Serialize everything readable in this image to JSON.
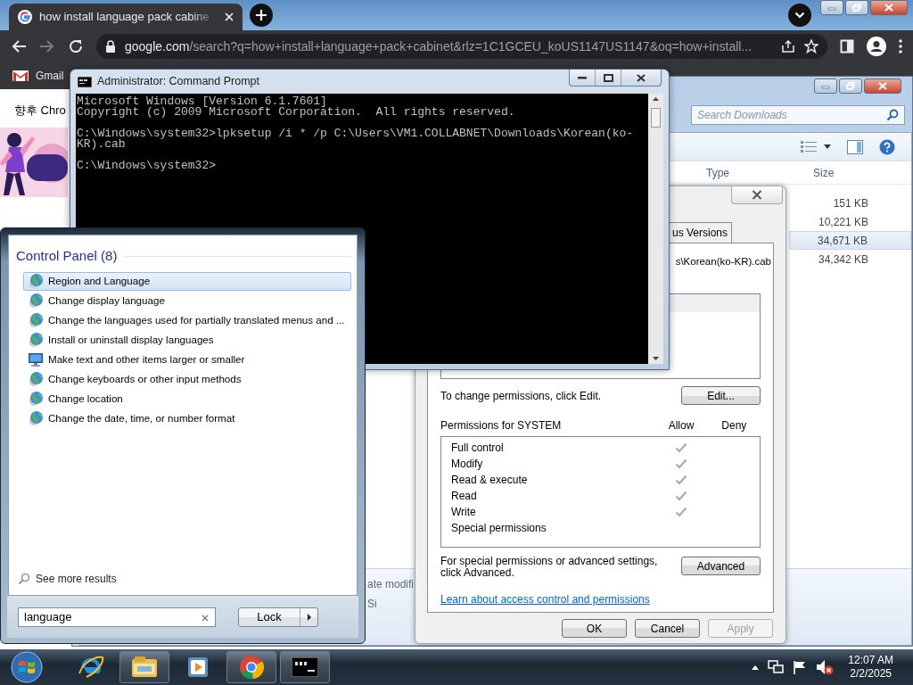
{
  "browser": {
    "tab_title": "how install language pack cabine",
    "url_host": "google.com",
    "url_rest": "/search?q=how+install+language+pack+cabinet&rlz=1C1GCEU_koUS1147US1147&oq=how+install...",
    "bookmarks": [
      "Gmail"
    ],
    "page_text": "향후 Chro"
  },
  "explorer": {
    "search_placeholder": "Search Downloads",
    "columns": [
      "Type",
      "Size"
    ],
    "rows": [
      {
        "size": "151 KB",
        "selected": false
      },
      {
        "size": "10,221 KB",
        "selected": false
      },
      {
        "size": "34,671 KB",
        "selected": true
      },
      {
        "size": "34,342 KB",
        "selected": false
      }
    ],
    "details": [
      "ate modifi",
      "Si"
    ]
  },
  "properties": {
    "tabs": [
      {
        "label": "us Versions",
        "selected": false
      }
    ],
    "path": "s\\Korean(ko-KR).cab",
    "edit_hint": "To change permissions, click Edit.",
    "edit_button": "Edit...",
    "permissions_label": "Permissions for SYSTEM",
    "permission_columns": [
      "Allow",
      "Deny"
    ],
    "permissions": [
      {
        "name": "Full control",
        "allow": true,
        "deny": false
      },
      {
        "name": "Modify",
        "allow": true,
        "deny": false
      },
      {
        "name": "Read & execute",
        "allow": true,
        "deny": false
      },
      {
        "name": "Read",
        "allow": true,
        "deny": false
      },
      {
        "name": "Write",
        "allow": true,
        "deny": false
      },
      {
        "name": "Special permissions",
        "allow": false,
        "deny": false
      }
    ],
    "advanced_hint": "For special permissions or advanced settings, click Advanced.",
    "advanced_button": "Advanced",
    "link": "Learn about access control and permissions",
    "buttons": [
      {
        "label": "OK",
        "disabled": false
      },
      {
        "label": "Cancel",
        "disabled": false
      },
      {
        "label": "Apply",
        "disabled": true
      }
    ]
  },
  "cmd": {
    "title": "Administrator: Command Prompt",
    "blocks": [
      [
        "Microsoft Windows [Version 6.1.7601]",
        "Copyright (c) 2009 Microsoft Corporation.  All rights reserved."
      ],
      [
        "C:\\Windows\\system32>lpksetup /i * /p C:\\Users\\VM1.COLLABNET\\Downloads\\Korean(ko-",
        "KR).cab"
      ],
      [
        "C:\\Windows\\system32>"
      ]
    ]
  },
  "start_menu": {
    "heading": "Control Panel (8)",
    "results": [
      {
        "label": "Region and Language",
        "kind": "globe",
        "selected": true
      },
      {
        "label": "Change display language",
        "kind": "globe",
        "selected": false
      },
      {
        "label": "Change the languages used for partially translated menus and ...",
        "kind": "globe",
        "selected": false
      },
      {
        "label": "Install or uninstall display languages",
        "kind": "globe",
        "selected": false
      },
      {
        "label": "Make text and other items larger or smaller",
        "kind": "monitor",
        "selected": false
      },
      {
        "label": "Change keyboards or other input methods",
        "kind": "globe",
        "selected": false
      },
      {
        "label": "Change location",
        "kind": "globe",
        "selected": false
      },
      {
        "label": "Change the date, time, or number format",
        "kind": "globe",
        "selected": false
      }
    ],
    "see_more": "See more results",
    "search_value": "language",
    "power_button": "Lock"
  },
  "taskbar": {
    "time": "12:07 AM",
    "date": "2/2/2025"
  }
}
